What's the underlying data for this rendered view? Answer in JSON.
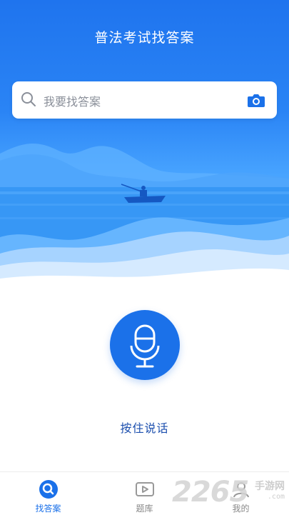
{
  "header": {
    "title": "普法考试找答案"
  },
  "search": {
    "placeholder": "我要找答案"
  },
  "voice": {
    "hold_to_talk": "按住说话"
  },
  "nav": {
    "items": [
      {
        "label": "找答案",
        "icon": "search-icon",
        "active": true
      },
      {
        "label": "题库",
        "icon": "play-icon",
        "active": false
      },
      {
        "label": "我的",
        "icon": "person-icon",
        "active": false
      }
    ]
  },
  "watermark": {
    "number": "2265",
    "text": "手游网",
    "url": ".com"
  },
  "colors": {
    "primary": "#1b71e9",
    "hero_top": "#1f74ee",
    "hero_bottom": "#48a4ff"
  }
}
